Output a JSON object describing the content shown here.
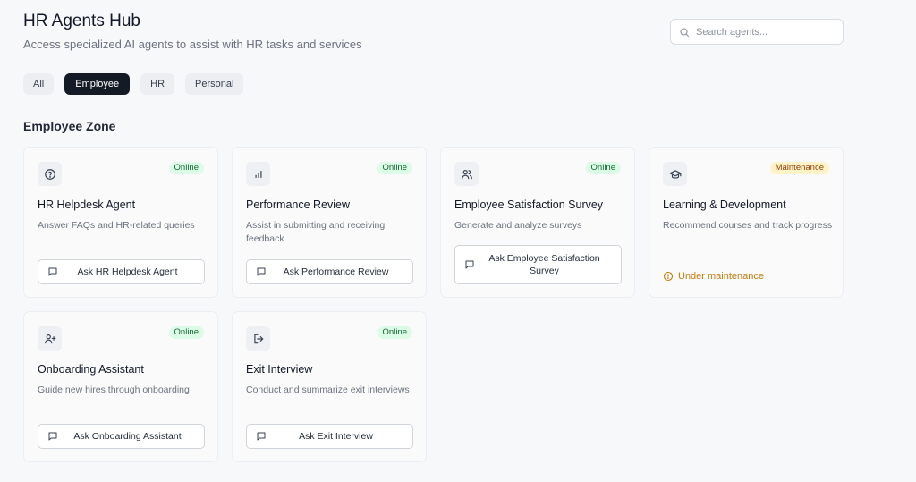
{
  "header": {
    "title": "HR Agents Hub",
    "subtitle": "Access specialized AI agents to assist with HR tasks and services"
  },
  "search": {
    "placeholder": "Search agents..."
  },
  "filters": {
    "all": "All",
    "employee": "Employee",
    "hr": "HR",
    "personal": "Personal",
    "active": "Employee"
  },
  "zone": {
    "title": "Employee Zone"
  },
  "cards": [
    {
      "icon": "help-circle-icon",
      "status": "Online",
      "title": "HR Helpdesk Agent",
      "description": "Answer FAQs and HR-related queries",
      "button": "Ask HR Helpdesk Agent"
    },
    {
      "icon": "bar-chart-icon",
      "status": "Online",
      "title": "Performance Review",
      "description": "Assist in submitting and receiving feedback",
      "button": "Ask Performance Review"
    },
    {
      "icon": "users-icon",
      "status": "Online",
      "title": "Employee Satisfaction Survey",
      "description": "Generate and analyze surveys",
      "button": "Ask Employee Satisfaction Survey"
    },
    {
      "icon": "graduation-cap-icon",
      "status": "Maintenance",
      "title": "Learning & Development",
      "description": "Recommend courses and track progress",
      "note": "Under maintenance"
    },
    {
      "icon": "user-plus-icon",
      "status": "Online",
      "title": "Onboarding Assistant",
      "description": "Guide new hires through onboarding",
      "button": "Ask Onboarding Assistant"
    },
    {
      "icon": "log-out-icon",
      "status": "Online",
      "title": "Exit Interview",
      "description": "Conduct and summarize exit interviews",
      "button": "Ask Exit Interview"
    }
  ],
  "colors": {
    "online_bg": "#dcfce7",
    "online_text": "#166534",
    "maintenance_bg": "#fef3c7",
    "maintenance_text": "#92400e",
    "warning": "#c27c0e",
    "active_tab": "#141a26"
  }
}
